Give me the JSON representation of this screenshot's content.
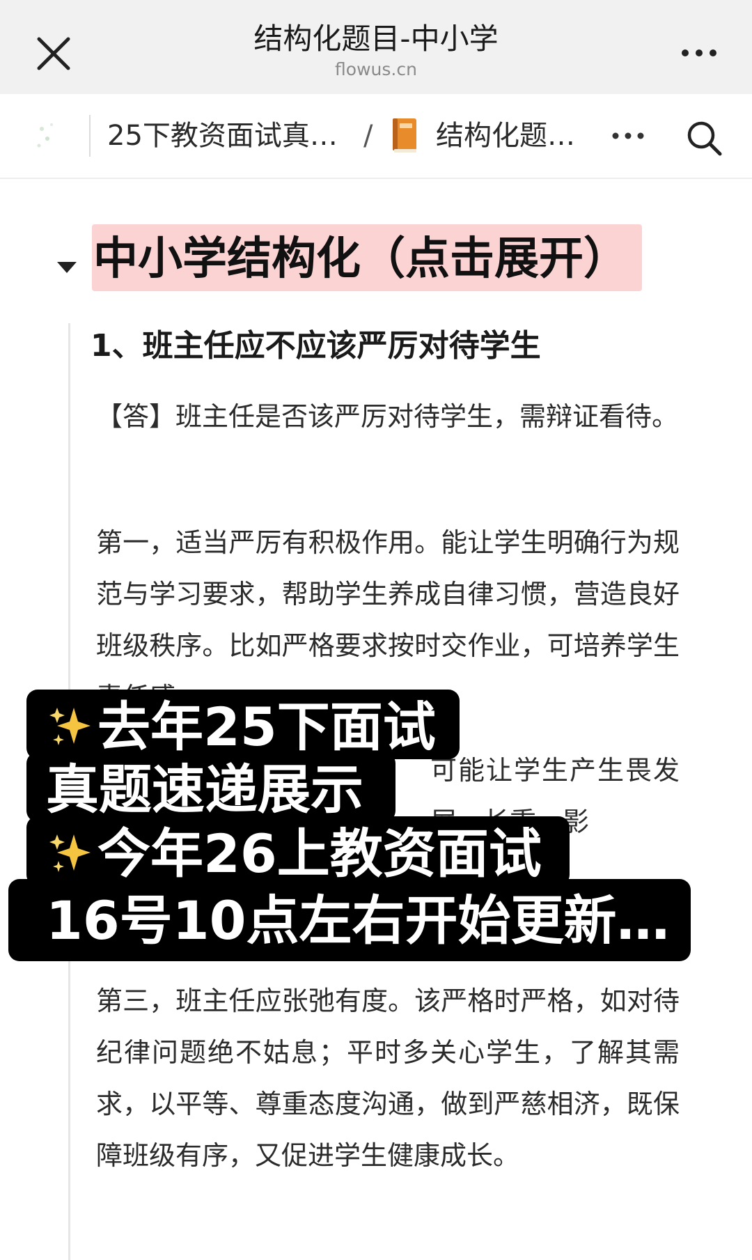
{
  "browser": {
    "title": "结构化题目-中小学",
    "domain": "flowus.cn"
  },
  "nav": {
    "crumb_parent": "25下教资面试真…",
    "crumb_separator": "/",
    "crumb_current": "结构化题…"
  },
  "content": {
    "toggle_heading": "中小学结构化（点击展开）",
    "question_title": "1、班主任应不应该严厉对待学生",
    "paragraphs": [
      "【答】班主任是否该严厉对待学生，需辩证看待。",
      "第一，适当严厉有积极作用。能让学生明确行为规范与学习要求，帮助学生养成自律习惯，营造良好班级秩序。比如严格要求按时交作业，可培养学生责任感。",
      "可能让学生产生畏发展。长重，影",
      "第三，班主任应张弛有度。该严格时严格，如对待纪律问题绝不姑息；平时多关心学生，了解其需求，以平等、尊重态度沟通，做到严慈相济，既保障班级有序，又促进学生健康成长。"
    ]
  },
  "overlay": {
    "line1": "去年25下面试",
    "line2": "真题速递展示",
    "line3": "今年26上教资面试",
    "line4": "16号10点左右开始更新…"
  },
  "icons": {
    "close": "close-icon",
    "more": "more-icon",
    "search": "search-icon",
    "book": "book-icon",
    "toggle": "triangle-down-icon",
    "sparkle": "sparkles-icon"
  },
  "colors": {
    "heading_highlight": "#fbd3d3",
    "overlay_bg": "#000000",
    "overlay_text": "#ffffff",
    "sparkle": "#f5c542"
  }
}
